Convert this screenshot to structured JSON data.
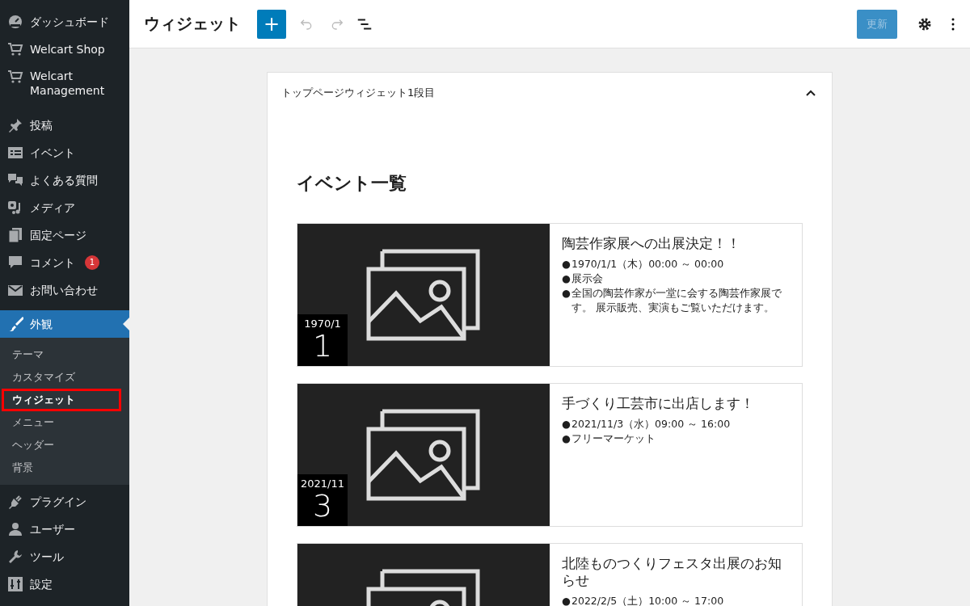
{
  "sidebar": {
    "items": [
      {
        "label": "ダッシュボード",
        "selected": false
      },
      {
        "label": "Welcart Shop",
        "selected": false
      },
      {
        "label": "Welcart Management",
        "selected": false
      },
      {
        "label": "投稿",
        "selected": false
      },
      {
        "label": "イベント",
        "selected": false
      },
      {
        "label": "よくある質問",
        "selected": false
      },
      {
        "label": "メディア",
        "selected": false
      },
      {
        "label": "固定ページ",
        "selected": false
      },
      {
        "label": "コメント",
        "selected": false,
        "badge": "1"
      },
      {
        "label": "お問い合わせ",
        "selected": false
      },
      {
        "label": "外観",
        "selected": true,
        "children": [
          {
            "label": "テーマ",
            "selected": false,
            "highlighted": false
          },
          {
            "label": "カスタマイズ",
            "selected": false,
            "highlighted": false
          },
          {
            "label": "ウィジェット",
            "selected": true,
            "highlighted": true
          },
          {
            "label": "メニュー",
            "selected": false,
            "highlighted": false
          },
          {
            "label": "ヘッダー",
            "selected": false,
            "highlighted": false
          },
          {
            "label": "背景",
            "selected": false,
            "highlighted": false
          }
        ]
      },
      {
        "label": "プラグイン",
        "selected": false
      },
      {
        "label": "ユーザー",
        "selected": false
      },
      {
        "label": "ツール",
        "selected": false
      },
      {
        "label": "設定",
        "selected": false
      }
    ]
  },
  "toolbar": {
    "title": "ウィジェット",
    "add_button": "+",
    "undo": {
      "disabled": true
    },
    "redo": {
      "disabled": true
    },
    "update_button": {
      "label": "更新",
      "disabled": true
    }
  },
  "widget_area": {
    "title": "トップページウィジェット1段目",
    "expanded": true,
    "heading": "イベント一覧",
    "events": [
      {
        "date_month": "1970/1",
        "date_day": "1",
        "title": "陶芸作家展への出展決定！！",
        "details": [
          {
            "bullet": "●",
            "text": "1970/1/1（木）00:00 ～ 00:00"
          },
          {
            "bullet": "●",
            "text": "展示会"
          },
          {
            "bullet": "●",
            "text": "全国の陶芸作家が一堂に会する陶芸作家展です。 展示販売、実演もご覧いただけます。"
          }
        ]
      },
      {
        "date_month": "2021/11",
        "date_day": "3",
        "title": "手づくり工芸市に出店します！",
        "details": [
          {
            "bullet": "●",
            "text": "2021/11/3（水）09:00 ～ 16:00"
          },
          {
            "bullet": "●",
            "text": "フリーマーケット"
          }
        ]
      },
      {
        "title": "北陸ものつくりフェスタ出展のお知らせ",
        "details": [
          {
            "bullet": "●",
            "text": "2022/2/5（土）10:00 ～ 17:00"
          }
        ]
      }
    ]
  }
}
